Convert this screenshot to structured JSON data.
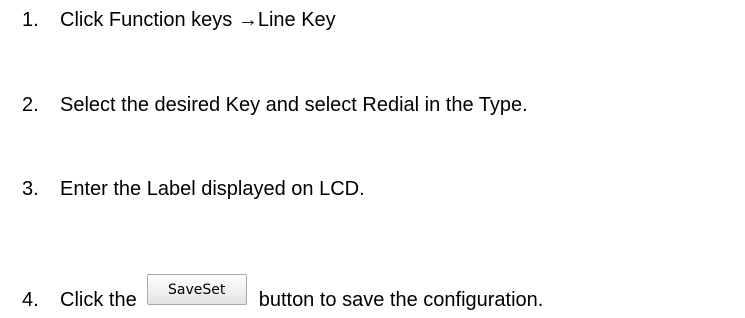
{
  "steps": [
    {
      "number": "1.",
      "text": "Click Function keys →Line Key"
    },
    {
      "number": "2.",
      "text": "Select the desired Key and select Redial in the Type."
    },
    {
      "number": "3.",
      "text": "Enter the Label displayed on LCD."
    },
    {
      "number": "4.",
      "text_before": "Click the",
      "button_label": "SaveSet",
      "text_after": "button to save the configuration."
    }
  ]
}
